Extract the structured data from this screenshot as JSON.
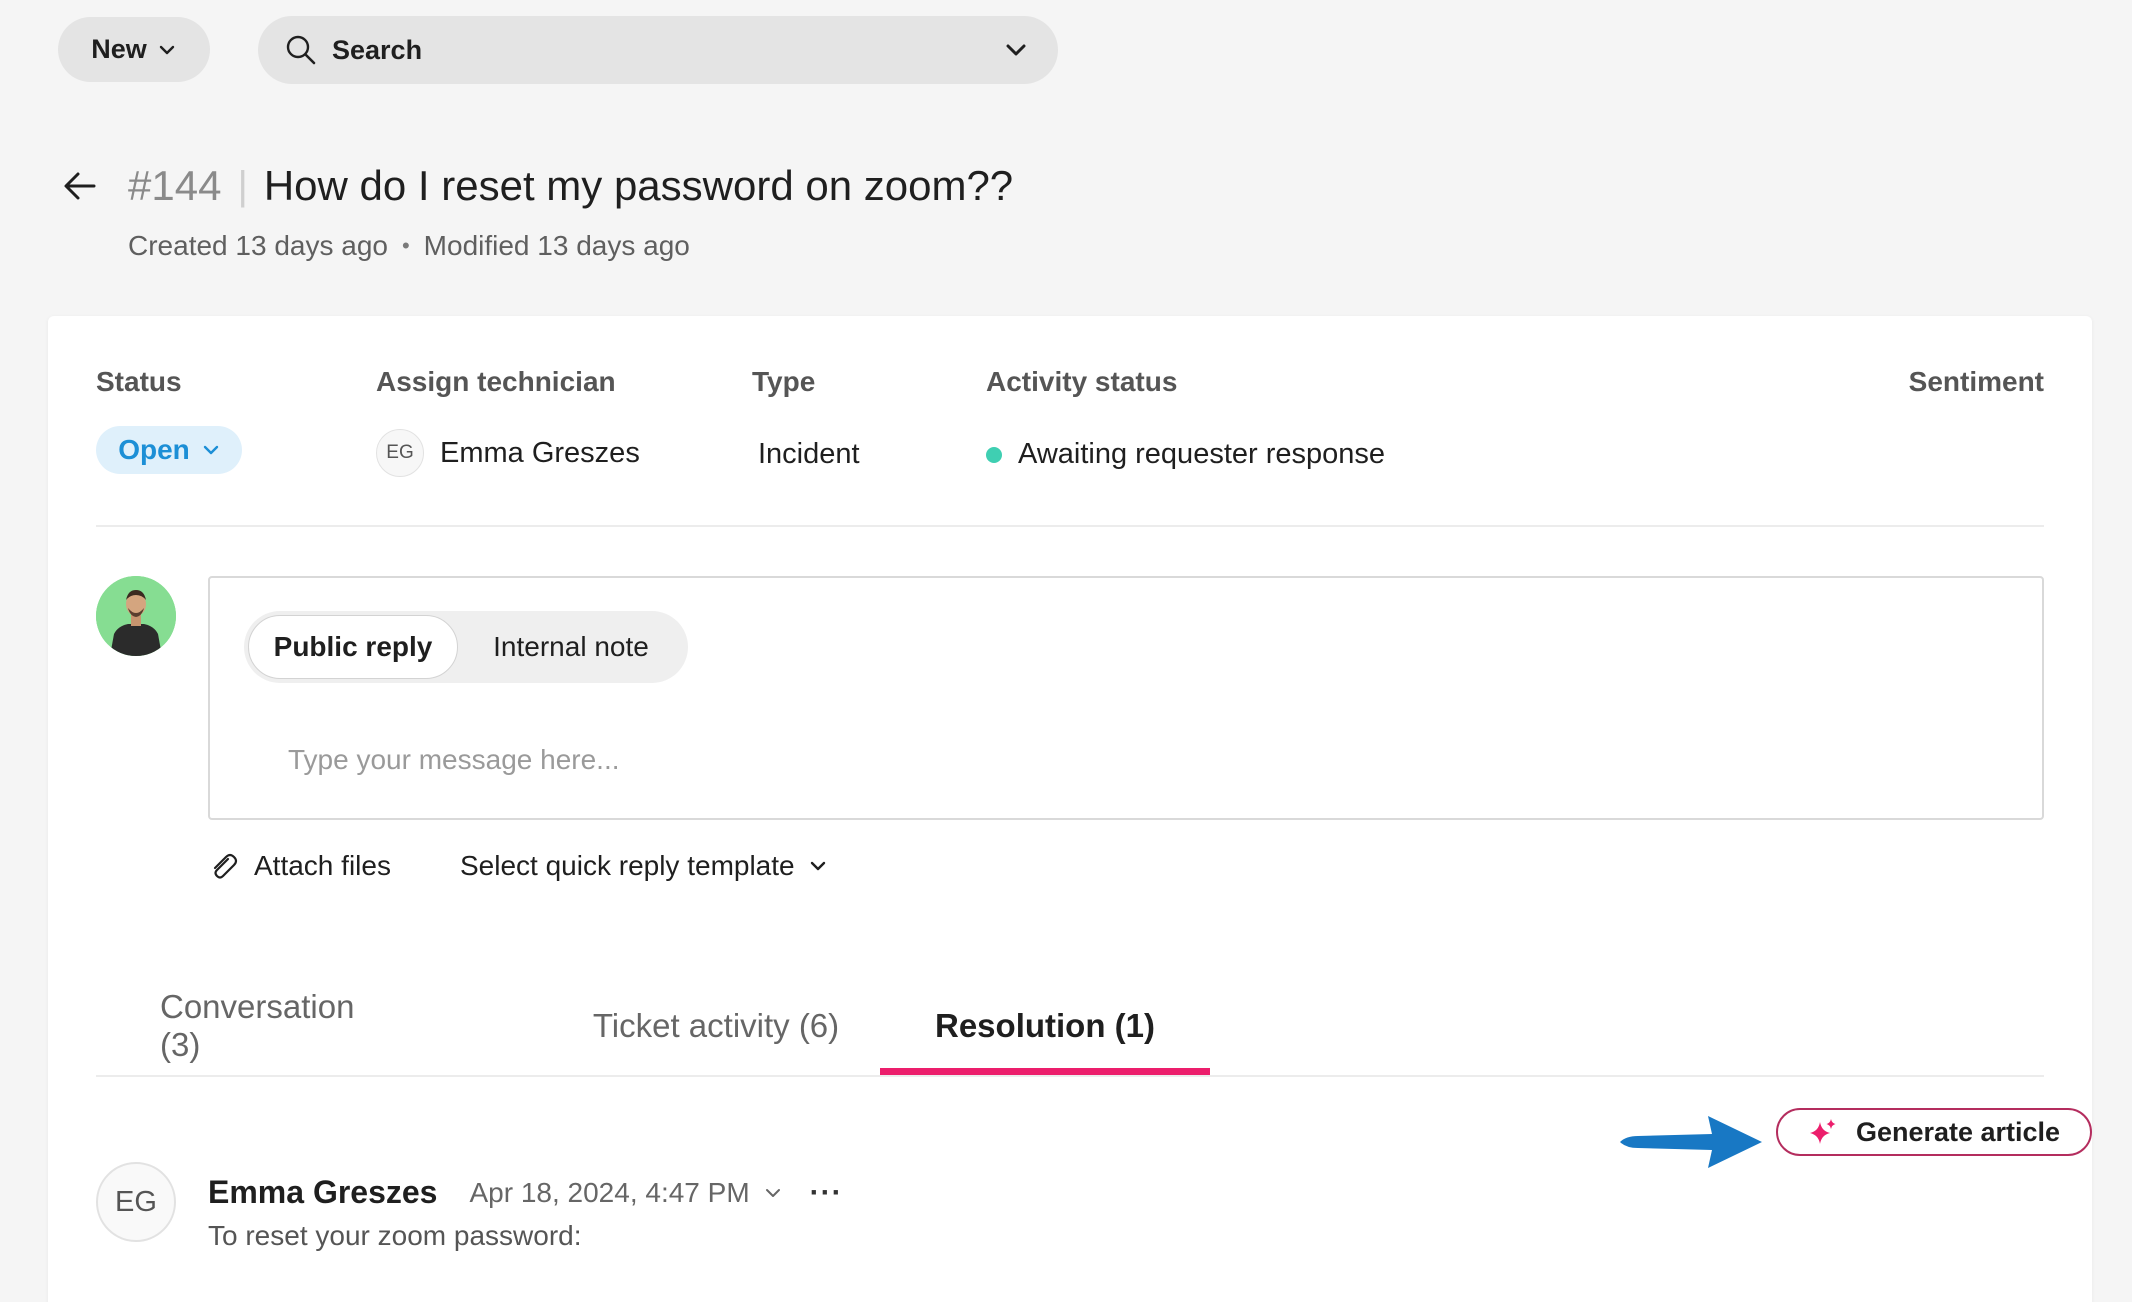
{
  "topbar": {
    "new_label": "New",
    "search_placeholder": "Search"
  },
  "ticket": {
    "id": "#144",
    "title": "How do I reset my password on zoom??",
    "created": "Created 13 days ago",
    "separator": "•",
    "modified": "Modified 13 days ago"
  },
  "fields": {
    "status_label": "Status",
    "status_value": "Open",
    "technician_label": "Assign technician",
    "technician_initials": "EG",
    "technician_name": "Emma Greszes",
    "type_label": "Type",
    "type_value": "Incident",
    "activity_label": "Activity status",
    "activity_value": "Awaiting requester response",
    "sentiment_label": "Sentiment"
  },
  "composer": {
    "public_reply": "Public reply",
    "internal_note": "Internal note",
    "placeholder": "Type your message here...",
    "attach_label": "Attach files",
    "template_label": "Select quick reply template"
  },
  "tabs": [
    {
      "label": "Conversation (3)",
      "active": false
    },
    {
      "label": "Ticket activity (6)",
      "active": false
    },
    {
      "label": "Resolution (1)",
      "active": true
    }
  ],
  "generate_article_label": "Generate article",
  "resolution_entry": {
    "initials": "EG",
    "author": "Emma Greszes",
    "timestamp": "Apr 18, 2024, 4:47 PM",
    "more": "···",
    "body": "To reset your zoom password:"
  },
  "colors": {
    "accent_pink": "#ec1e6c",
    "status_blue": "#1c8fd6",
    "status_bg": "#dff0fb",
    "activity_teal": "#3fcfb2",
    "arrow_blue": "#1878c4"
  }
}
